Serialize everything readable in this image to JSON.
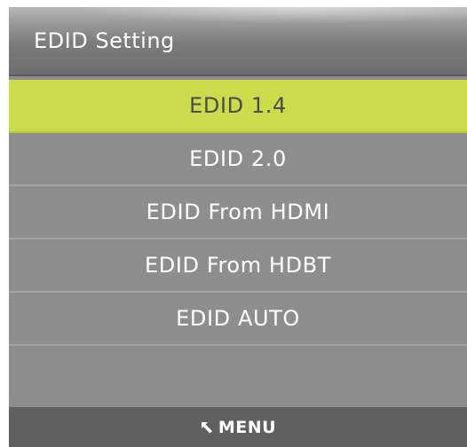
{
  "header": {
    "title": "EDID Setting"
  },
  "menu": {
    "items": [
      {
        "label": "EDID 1.4",
        "selected": true
      },
      {
        "label": "EDID 2.0",
        "selected": false
      },
      {
        "label": "EDID From HDMI",
        "selected": false
      },
      {
        "label": "EDID From HDBT",
        "selected": false
      },
      {
        "label": "EDID AUTO",
        "selected": false
      }
    ]
  },
  "footer": {
    "icon": "return-arrow-icon",
    "label": "MENU"
  },
  "colors": {
    "selected_bg": "#cadc4c",
    "item_bg": "#8e8e8e",
    "footer_bg": "#606060"
  }
}
